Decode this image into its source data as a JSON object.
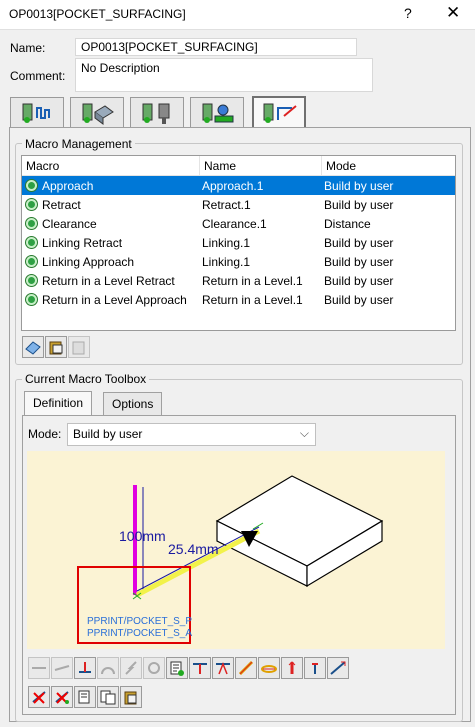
{
  "window": {
    "title": "OP0013[POCKET_SURFACING]",
    "help": "?",
    "close": "✕"
  },
  "form": {
    "name_label": "Name:",
    "name_value": "OP0013[POCKET_SURFACING]",
    "comment_label": "Comment:",
    "comment_value": "No Description"
  },
  "top_tabs": [
    {
      "icon": "strategy-tab-icon"
    },
    {
      "icon": "geometry-tab-icon"
    },
    {
      "icon": "tool-tab-icon"
    },
    {
      "icon": "feeds-speeds-tab-icon"
    },
    {
      "icon": "macros-tab-icon",
      "active": true
    }
  ],
  "macro_management": {
    "title": "Macro Management",
    "columns": [
      "Macro",
      "Name",
      "Mode"
    ],
    "rows": [
      {
        "macro": "Approach",
        "name": "Approach.1",
        "mode": "Build by user",
        "selected": true
      },
      {
        "macro": "Retract",
        "name": "Retract.1",
        "mode": "Build by user"
      },
      {
        "macro": "Clearance",
        "name": "Clearance.1",
        "mode": "Distance"
      },
      {
        "macro": "Linking Retract",
        "name": "Linking.1",
        "mode": "Build by user"
      },
      {
        "macro": "Linking Approach",
        "name": "Linking.1",
        "mode": "Build by user"
      },
      {
        "macro": "Return in a Level Retract",
        "name": "Return in a Level.1",
        "mode": "Build by user"
      },
      {
        "macro": "Return in a Level Approach",
        "name": "Return in a Level.1",
        "mode": "Build by user"
      }
    ]
  },
  "toolbox": {
    "title": "Current Macro Toolbox",
    "tabs": [
      "Definition",
      "Options"
    ],
    "mode_label": "Mode:",
    "mode_value": "Build by user",
    "diagram": {
      "dim_vertical": "100mm",
      "dim_horizontal": "25.4mm",
      "pprint_1": "PPRINT/POCKET_S_P",
      "pprint_2": "PPRINT/POCKET_S_A"
    }
  },
  "colors": {
    "selection": "#0078d7",
    "diagram_bg": "#fbf3d4",
    "magenta": "#e000e0",
    "yellow": "#f2f24a",
    "dim_blue": "#1a1aa0",
    "highlight_red": "#e00000"
  }
}
